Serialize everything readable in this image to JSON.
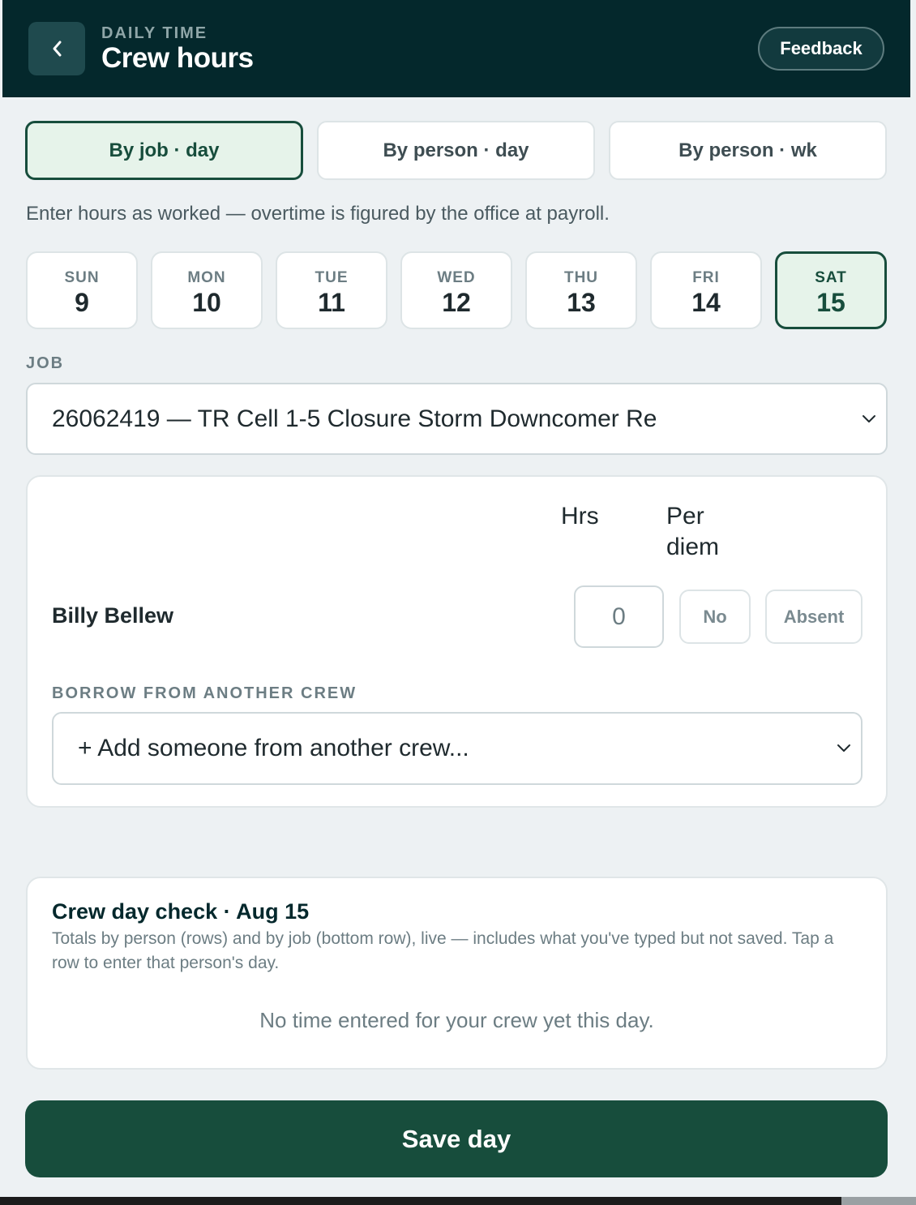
{
  "header": {
    "eyebrow": "DAILY TIME",
    "title": "Crew hours",
    "feedback_label": "Feedback",
    "back_icon": "chevron-left-icon"
  },
  "modes": [
    {
      "label": "By job · day",
      "active": true
    },
    {
      "label": "By person · day",
      "active": false
    },
    {
      "label": "By person · wk",
      "active": false
    }
  ],
  "hint": "Enter hours as worked — overtime is figured by the office at payroll.",
  "days": [
    {
      "dow": "SUN",
      "num": "9",
      "active": false
    },
    {
      "dow": "MON",
      "num": "10",
      "active": false
    },
    {
      "dow": "TUE",
      "num": "11",
      "active": false
    },
    {
      "dow": "WED",
      "num": "12",
      "active": false
    },
    {
      "dow": "THU",
      "num": "13",
      "active": false
    },
    {
      "dow": "FRI",
      "num": "14",
      "active": false
    },
    {
      "dow": "SAT",
      "num": "15",
      "active": true
    }
  ],
  "job": {
    "label": "JOB",
    "selected": "26062419 — TR Cell 1-5 Closure Storm Downcomer Re"
  },
  "crew_table": {
    "col_hours": "Hrs",
    "col_per_diem": "Per diem",
    "rows": [
      {
        "name": "Billy Bellew",
        "hours_placeholder": "0",
        "per_diem": "No",
        "absent_label": "Absent"
      }
    ],
    "borrow_label": "BORROW FROM ANOTHER CREW",
    "borrow_placeholder": "+ Add someone from another crew..."
  },
  "crew_check": {
    "title": "Crew day check · Aug 15",
    "description": "Totals by person (rows) and by job (bottom row), live — includes what you've typed but not saved. Tap a row to enter that person's day.",
    "empty": "No time entered for your crew yet this day."
  },
  "save_label": "Save day",
  "colors": {
    "header_bg": "#04282c",
    "accent": "#174d3c",
    "active_bg": "#e6f3ea",
    "page_bg": "#edf1f3"
  }
}
